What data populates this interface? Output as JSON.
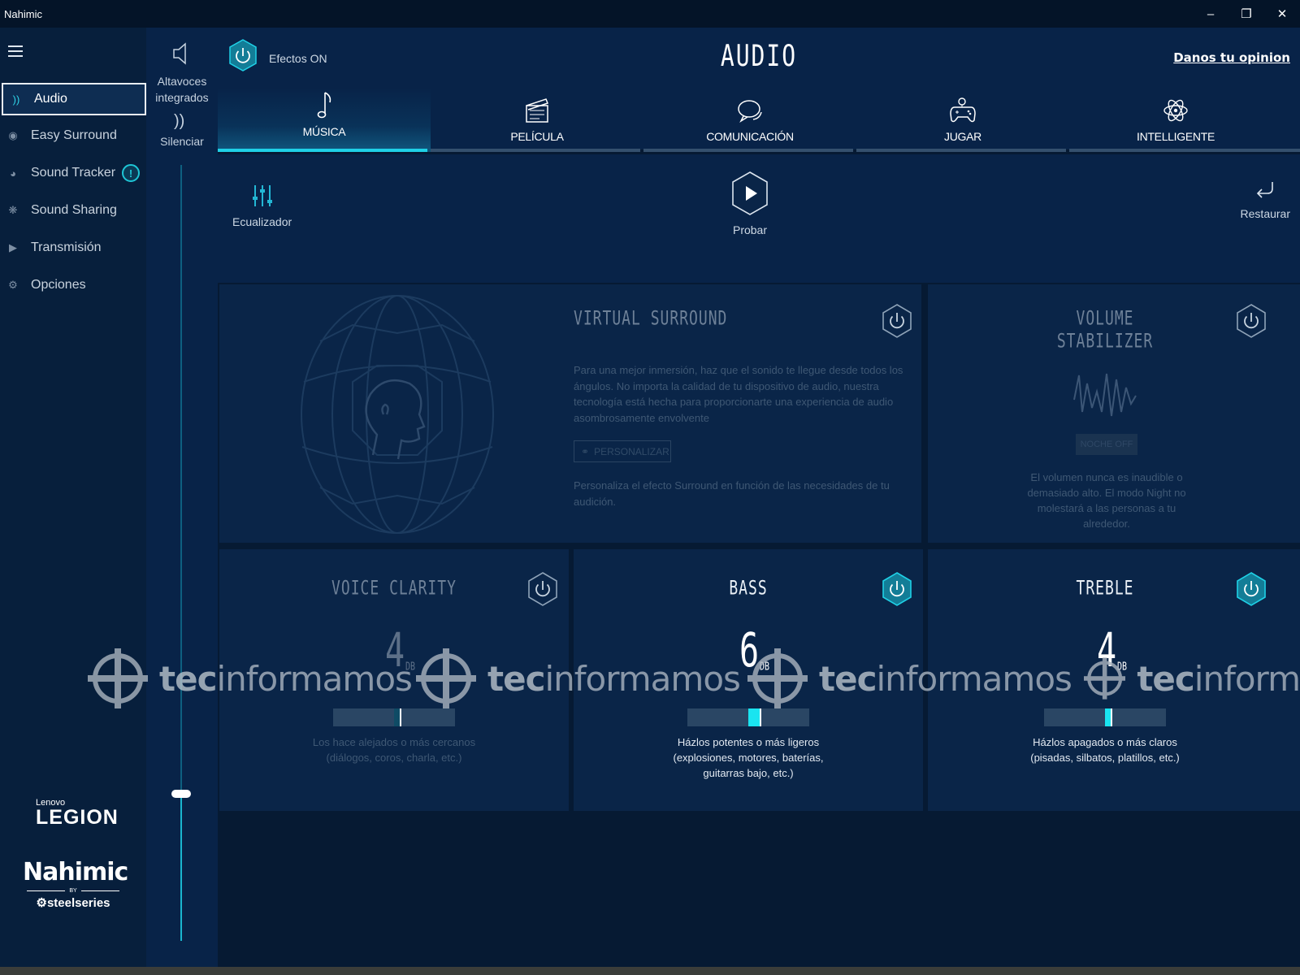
{
  "window": {
    "title": "Nahimic",
    "controls": [
      "minimize",
      "restore",
      "close"
    ]
  },
  "sidebar": {
    "items": [
      {
        "label": "Audio",
        "icon": "audio-wave-icon",
        "active": true
      },
      {
        "label": "Easy Surround",
        "icon": "surround-icon"
      },
      {
        "label": "Sound Tracker",
        "icon": "tracker-icon",
        "badge": "!"
      },
      {
        "label": "Sound Sharing",
        "icon": "sharing-icon"
      },
      {
        "label": "Transmisión",
        "icon": "stream-icon"
      },
      {
        "label": "Opciones",
        "icon": "gear-icon"
      }
    ],
    "brand": {
      "legion_small": "Lenovo",
      "legion": "LEGION",
      "nahimic": "Nahimic",
      "by": "BY",
      "steelseries": "steelseries"
    }
  },
  "devices": {
    "speaker_label": "Altavoces integrados",
    "mute_label": "Silenciar",
    "volume": 0.19
  },
  "header": {
    "effects_label": "Efectos ON",
    "title": "AUDIO",
    "feedback_link": "Danos tu opinion"
  },
  "tabs": [
    {
      "label": "MÚSICA",
      "icon": "music-note-icon",
      "active": true
    },
    {
      "label": "PELÍCULA",
      "icon": "clapperboard-icon"
    },
    {
      "label": "COMUNICACIÓN",
      "icon": "chat-bubbles-icon"
    },
    {
      "label": "JUGAR",
      "icon": "gamepad-icon"
    },
    {
      "label": "INTELLIGENTE",
      "icon": "atom-icon"
    }
  ],
  "toolbar": {
    "equalizer": "Ecualizador",
    "play": "Probar",
    "restore": "Restaurar"
  },
  "cards": {
    "virtual_surround": {
      "title": "VIRTUAL SURROUND",
      "enabled": false,
      "description": "Para una mejor inmersión, haz que el sonido te llegue desde todos los ángulos. No importa la calidad de tu dispositivo de audio, nuestra tecnología está hecha para proporcionarte una experiencia de audio asombrosamente envolvente",
      "button": "PERSONALIZAR",
      "sub": "Personaliza el efecto Surround en función de las necesidades de tu audición."
    },
    "volume_stabilizer": {
      "title_line1": "VOLUME",
      "title_line2": "STABILIZER",
      "enabled": false,
      "night_button": "NOCHE OFF",
      "description": "El volumen nunca es inaudible o demasiado alto. El modo Night no molestará a las personas a tu alrededor."
    },
    "voice_clarity": {
      "title": "VOICE CLARITY",
      "enabled": false,
      "value": "4",
      "unit": "DB",
      "level": 0.55,
      "description": "Los hace alejados o más cercanos (diálogos, coros, charla, etc.)"
    },
    "bass": {
      "title": "BASS",
      "enabled": true,
      "value": "6",
      "unit": "DB",
      "level": 0.6,
      "description": "Házlos potentes o más ligeros (explosiones, motores, baterías, guitarras bajo, etc.)"
    },
    "treble": {
      "title": "TREBLE",
      "enabled": true,
      "value": "4",
      "unit": "DB",
      "level": 0.55,
      "description": "Házlos apagados o más claros (pisadas, silbatos, platillos, etc.)"
    }
  },
  "watermark": {
    "brand_bold": "tec",
    "brand_rest": "informamos",
    "brand_cut": "inform"
  },
  "colors": {
    "accent": "#1fd0e6",
    "panel": "#0a2548",
    "background": "#061a33"
  }
}
